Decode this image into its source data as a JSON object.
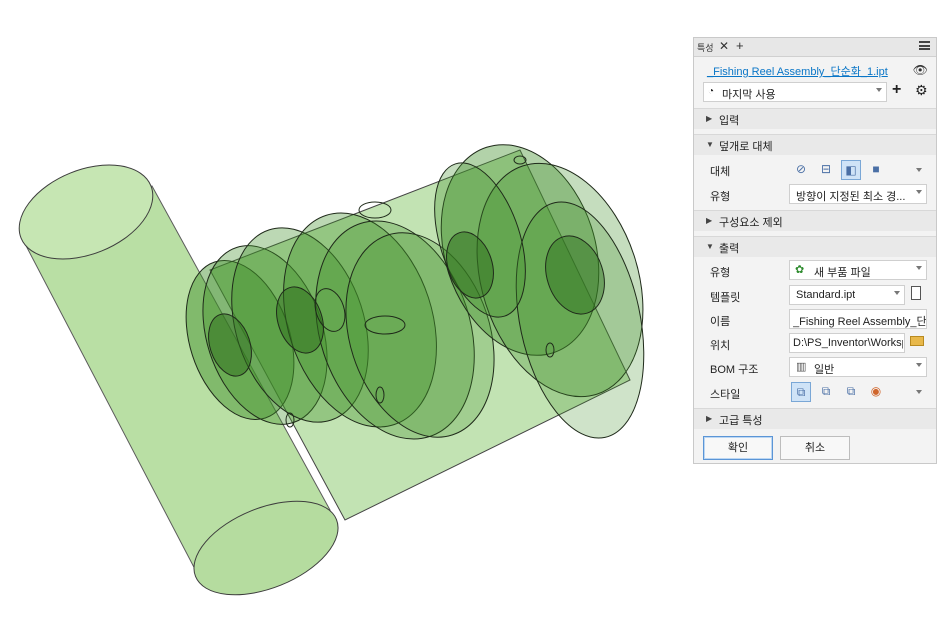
{
  "panel": {
    "tab_label": "특성",
    "tab_close": "✕",
    "tab_add": "+",
    "file_link": "_Fishing Reel Assembly_단순화_1.ipt",
    "preset_value": "마지막 사용",
    "sections": {
      "input": "입력",
      "envelope": "덮개로 대체",
      "exclude": "구성요소 제외",
      "output": "출력",
      "advanced": "고급 특성"
    },
    "envelope_fields": {
      "replace_label": "대체",
      "type_label": "유형",
      "type_value": "방향이 지정된 최소 경..."
    },
    "output_fields": {
      "type_label": "유형",
      "type_value": "새 부품 파일",
      "template_label": "템플릿",
      "template_value": "Standard.ipt",
      "name_label": "이름",
      "name_value": "_Fishing Reel Assembly_단순화",
      "location_label": "위치",
      "location_value": "D:\\PS_Inventor\\Workspace",
      "bom_label": "BOM 구조",
      "bom_value": "일반",
      "style_label": "스타일"
    },
    "ok_label": "확인",
    "cancel_label": "취소"
  },
  "icons": [
    "history-icon",
    "add-icon",
    "gear-icon",
    "eye-icon",
    "menu-icon",
    "none-icon",
    "bounding-box-icon",
    "oriented-box-icon",
    "cube-icon",
    "new-part-icon",
    "file-icon",
    "bom-icon",
    "folder-icon",
    "style-solid-icon",
    "style-merge-icon",
    "style-separate-icon",
    "style-color-icon"
  ],
  "colors": {
    "link": "#0a76c7",
    "selected_bg": "#cfe3f7",
    "model_fill": "#2f8a1e",
    "pipe_fill": "#b6dda1"
  }
}
